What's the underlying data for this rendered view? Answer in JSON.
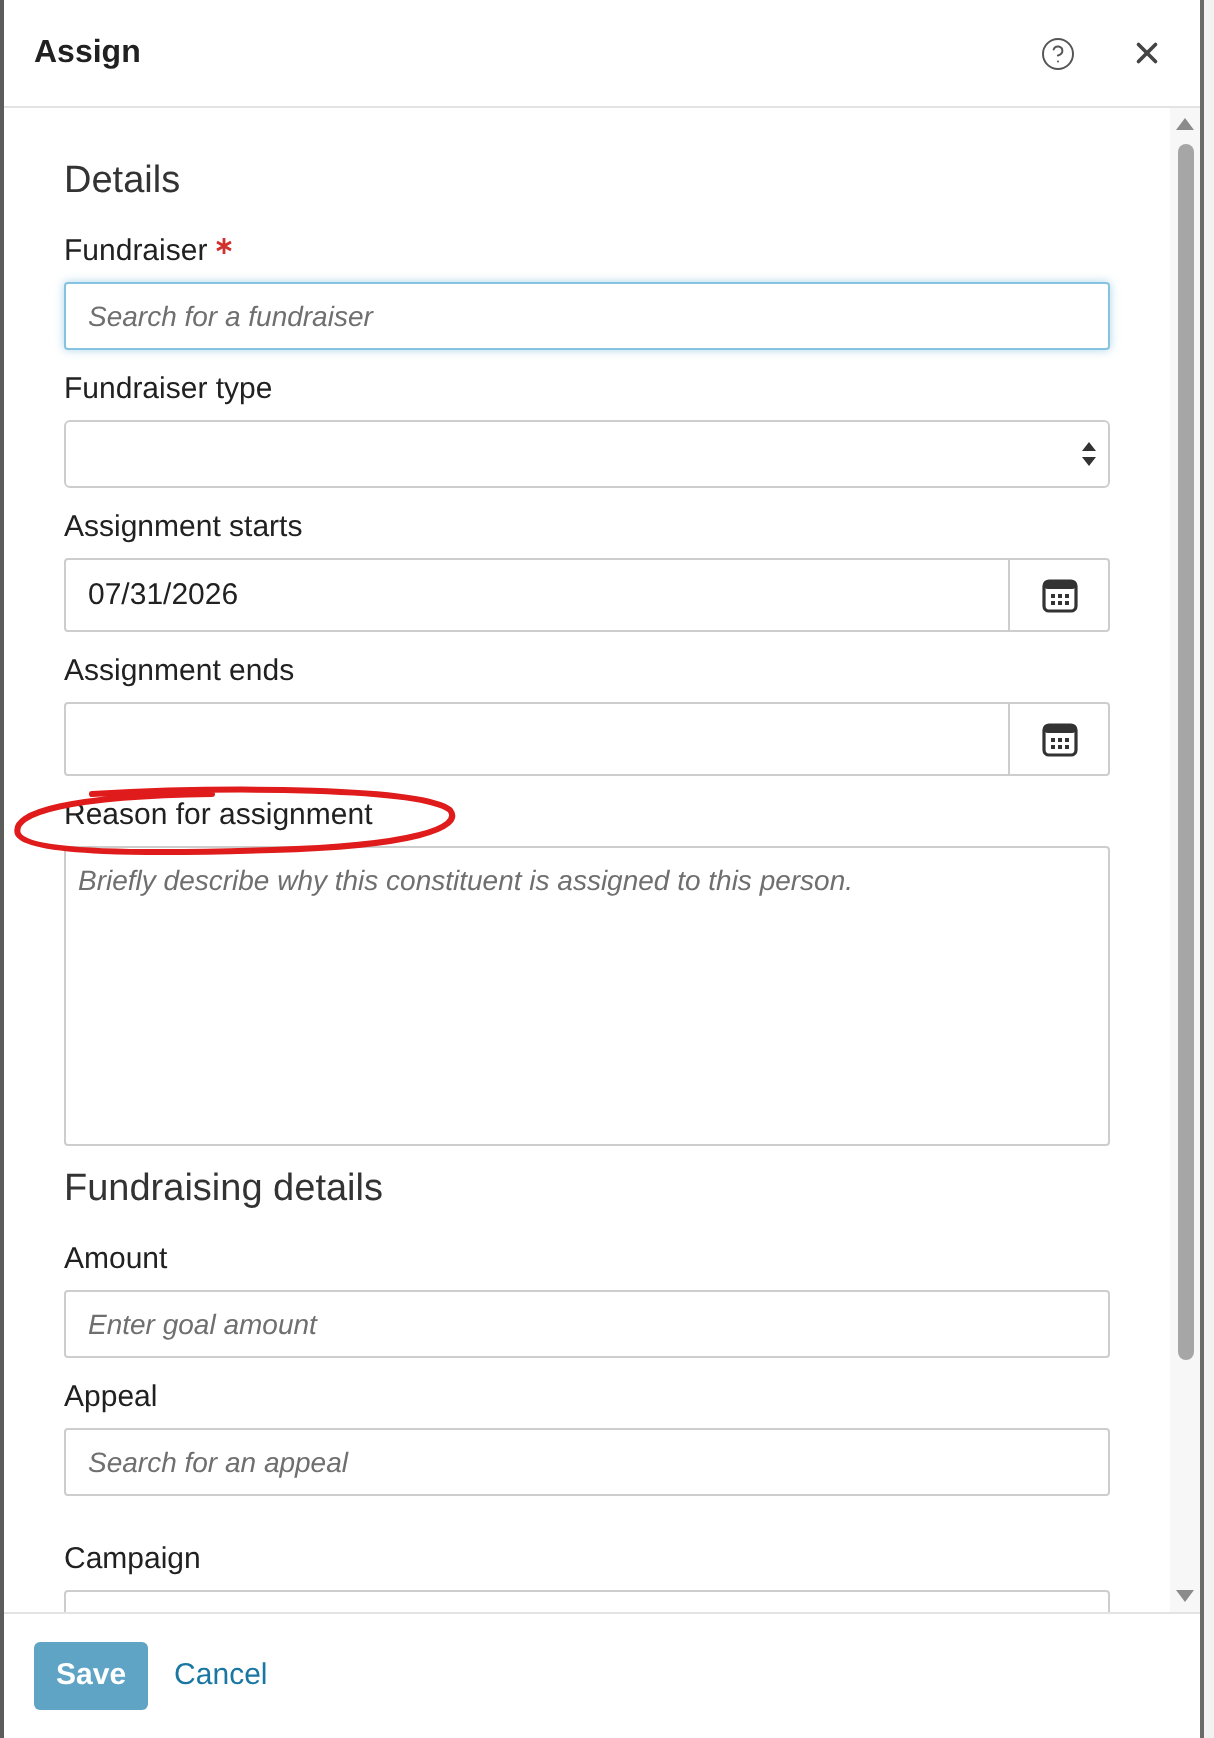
{
  "dialog": {
    "title": "Assign"
  },
  "sections": [
    {
      "heading": "Details",
      "fields": [
        {
          "kind": "search",
          "label": "Fundraiser",
          "required": true,
          "focused": true,
          "circled": false,
          "placeholder": "Search for a fundraiser"
        },
        {
          "kind": "select",
          "label": "Fundraiser type",
          "required": false,
          "focused": false,
          "circled": false
        },
        {
          "kind": "date",
          "label": "Assignment starts",
          "required": false,
          "focused": false,
          "circled": false,
          "value": "07/31/2026"
        },
        {
          "kind": "date",
          "label": "Assignment ends",
          "required": false,
          "focused": false,
          "circled": false
        },
        {
          "kind": "textarea",
          "label": "Reason for assignment",
          "required": false,
          "focused": false,
          "circled": true,
          "placeholder": "Briefly describe why this constituent is assigned to this person."
        }
      ]
    },
    {
      "heading": "Fundraising details",
      "fields": [
        {
          "kind": "text",
          "label": "Amount",
          "required": false,
          "focused": false,
          "circled": false,
          "placeholder": "Enter goal amount"
        },
        {
          "kind": "lookup",
          "label": "Appeal",
          "required": false,
          "focused": false,
          "circled": false,
          "placeholder": "Search for an appeal"
        },
        {
          "kind": "text",
          "label": "Campaign",
          "required": false,
          "focused": false,
          "circled": false
        }
      ]
    }
  ],
  "footer": {
    "buttons": [
      {
        "kind": "primary",
        "label": "Save"
      },
      {
        "kind": "link",
        "label": "Cancel"
      }
    ]
  }
}
